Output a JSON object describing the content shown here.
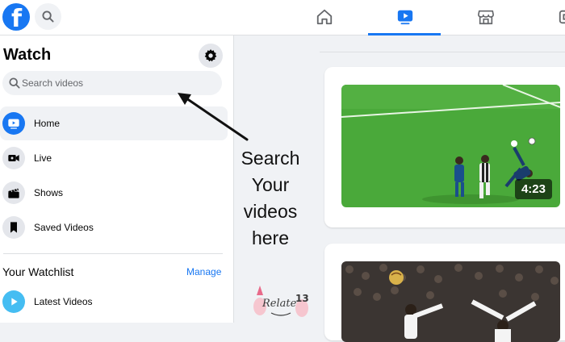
{
  "topbar": {
    "logo_letter": "f",
    "icons": {
      "search": "search-icon",
      "home": "home-icon",
      "watch": "watch-play-icon",
      "marketplace": "marketplace-store-icon",
      "gaming": "gaming-icon"
    }
  },
  "sidebar": {
    "title": "Watch",
    "search": {
      "placeholder": "Search videos"
    },
    "items": [
      {
        "label": "Home",
        "icon": "home-play-icon",
        "active": true
      },
      {
        "label": "Live",
        "icon": "live-camera-icon"
      },
      {
        "label": "Shows",
        "icon": "shows-clapper-icon"
      },
      {
        "label": "Saved Videos",
        "icon": "bookmark-icon"
      }
    ],
    "watchlist": {
      "title": "Your Watchlist",
      "manage_label": "Manage",
      "items": [
        {
          "label": "Latest Videos",
          "icon": "play-icon"
        }
      ]
    }
  },
  "feed": {
    "videos": [
      {
        "duration": "4:23",
        "scene": "soccer bicycle kick on green pitch"
      },
      {
        "duration": "",
        "scene": "soccer bicycle kick in stadium"
      }
    ]
  },
  "annotation": {
    "lines": [
      "Search",
      "Your",
      "videos",
      "here"
    ]
  },
  "watermark": {
    "text": "Relate13"
  },
  "colors": {
    "accent": "#1877f2",
    "background": "#f0f2f5",
    "panel": "#ffffff",
    "pitch_green": "#4aa93a"
  }
}
